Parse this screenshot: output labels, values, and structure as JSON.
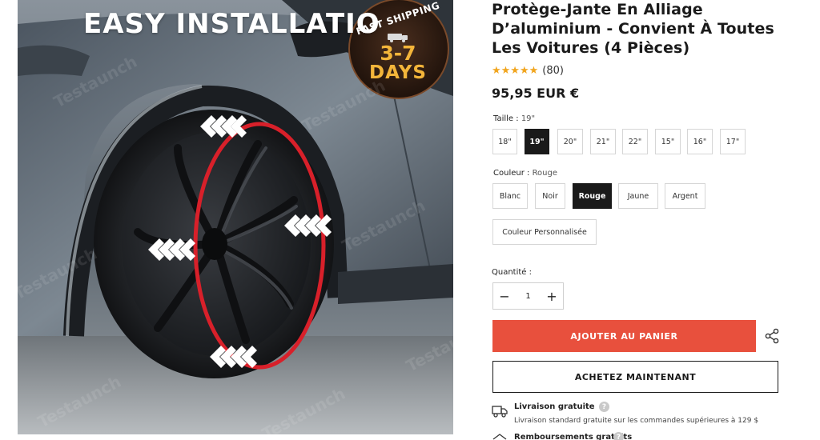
{
  "image": {
    "headline": "EASY INSTALLATIO",
    "badge": {
      "line1": "FAST SHIPPING",
      "line2": "3-7",
      "line3": "DAYS"
    },
    "watermark": "Testaunch"
  },
  "product": {
    "title_line1": "Protège-Jante En Alliage",
    "title_line2": "D’aluminium - Convient À Toutes",
    "title_line3": "Les Voitures (4 Pièces)",
    "stars": "★★★★★",
    "rating_count": "(80)",
    "price": "95,95 EUR €"
  },
  "size": {
    "label": "Taille :",
    "selected": "19\"",
    "options": [
      "18\"",
      "19\"",
      "20\"",
      "21\"",
      "22\"",
      "15\"",
      "16\"",
      "17\""
    ]
  },
  "color": {
    "label": "Couleur :",
    "selected": "Rouge",
    "options": [
      "Blanc",
      "Noir",
      "Rouge",
      "Jaune",
      "Argent",
      "Couleur Personnalisée"
    ]
  },
  "quantity": {
    "label": "Quantité :",
    "value": "1",
    "minus": "−",
    "plus": "+"
  },
  "actions": {
    "add_to_cart": "AJOUTER AU PANIER",
    "buy_now": "ACHETEZ MAINTENANT"
  },
  "shipping": {
    "title": "Livraison gratuite",
    "description": "Livraison standard gratuite sur les commandes supérieures à 129 $",
    "help": "?"
  },
  "refund": {
    "title": "Remboursements gratuits",
    "help": "?"
  },
  "colors": {
    "accent": "#e8503d",
    "selected_bg": "#1a1a1a",
    "stars": "#f1a51e",
    "ring": "#d8202a"
  }
}
